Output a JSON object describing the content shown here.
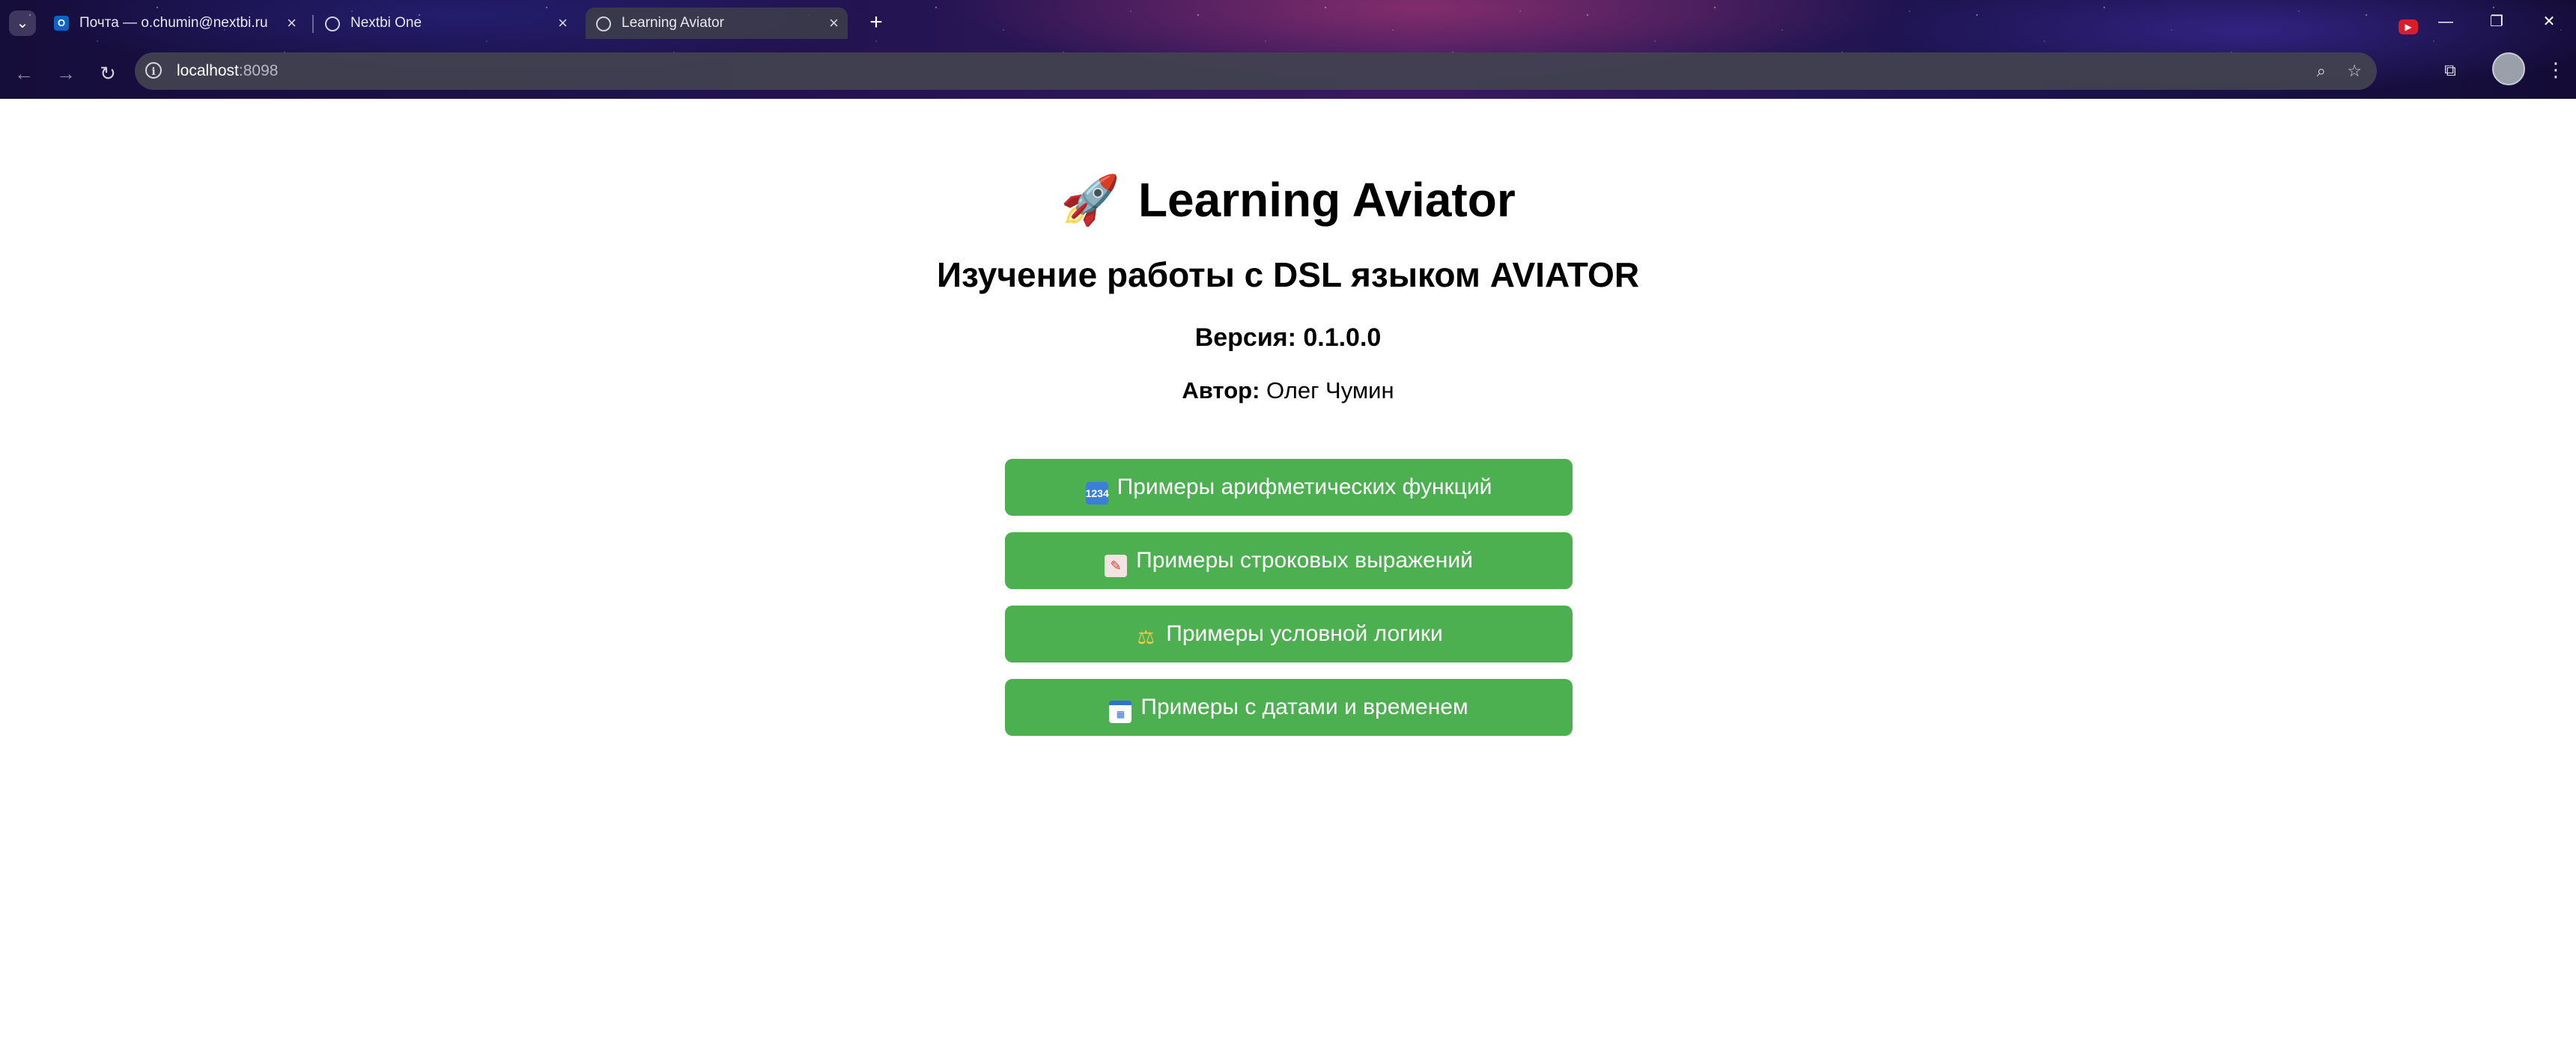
{
  "browser": {
    "tabs": [
      {
        "title": "Почта — o.chumin@nextbi.ru",
        "icon": "outlook-icon",
        "active": false
      },
      {
        "title": "Nextbi One",
        "icon": "globe-icon",
        "active": false
      },
      {
        "title": "Learning Aviator",
        "icon": "globe-icon",
        "active": true
      }
    ],
    "url_host": "localhost",
    "url_port": ":8098"
  },
  "app": {
    "title": "Learning Aviator",
    "title_icon": "🚀",
    "subtitle": "Изучение работы с DSL языком AVIATOR",
    "version": "Версия: 0.1.0.0",
    "author_label": "Автор:",
    "author_name": "Олег Чумин"
  },
  "menu": [
    {
      "label": "Примеры арифметических функций",
      "icon": "numbers-icon"
    },
    {
      "label": "Примеры строковых выражений",
      "icon": "memo-icon"
    },
    {
      "label": "Примеры условной логики",
      "icon": "scales-icon"
    },
    {
      "label": "Примеры с датами и временем",
      "icon": "calendar-icon"
    }
  ],
  "colors": {
    "button_bg": "#4caf50",
    "button_text": "#ffffff"
  }
}
